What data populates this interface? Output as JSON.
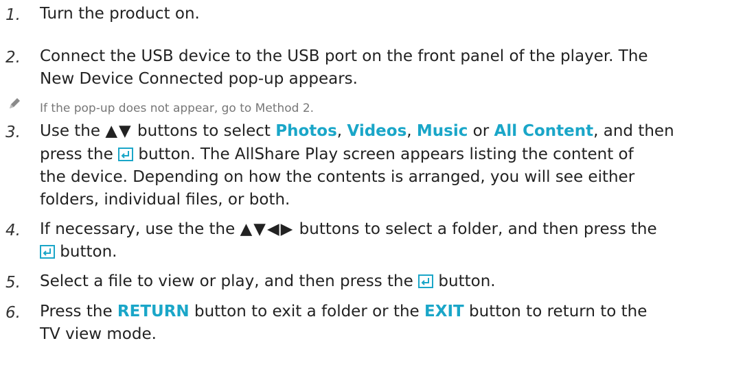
{
  "steps": [
    {
      "num": "1.",
      "text": "Turn the product on."
    },
    {
      "num": "2.",
      "l1": "Connect the USB device to the USB port on the front panel of the player. The",
      "l2": "New Device Connected pop-up appears."
    },
    {
      "num": "3.",
      "a1": "Use the ",
      "arrows": "▲▼",
      "a2": " buttons to select ",
      "photos": "Photos",
      "c1": ", ",
      "videos": "Videos",
      "c2": ", ",
      "music": "Music",
      "or": " or ",
      "all": "All Content",
      "a3": ", and then",
      "b1": "press the ",
      "b2": " button. The AllShare Play screen appears listing the content of",
      "l3": "the device. Depending on how the contents is arranged, you will see either",
      "l4": "folders, individual files, or both."
    },
    {
      "num": "4.",
      "a1": "If necessary, use the the ",
      "arrows": "▲▼◀▶",
      "a2": " buttons to select a folder, and then press the",
      "b2": " button."
    },
    {
      "num": "5.",
      "a1": "Select a file to view or play, and then press the ",
      "a2": " button."
    },
    {
      "num": "6.",
      "a1": "Press the ",
      "ret": "RETURN",
      "a2": " button to exit a folder or the ",
      "exit": "EXIT",
      "a3": " button to return to the",
      "l2": "TV view mode."
    }
  ],
  "note": "If the pop-up does not appear, go to Method 2.",
  "icons": {
    "note": "pencil-icon",
    "enter": "enter-button-icon"
  },
  "colors": {
    "highlight": "#1aa6c8",
    "icon": "#1aa6c8"
  }
}
